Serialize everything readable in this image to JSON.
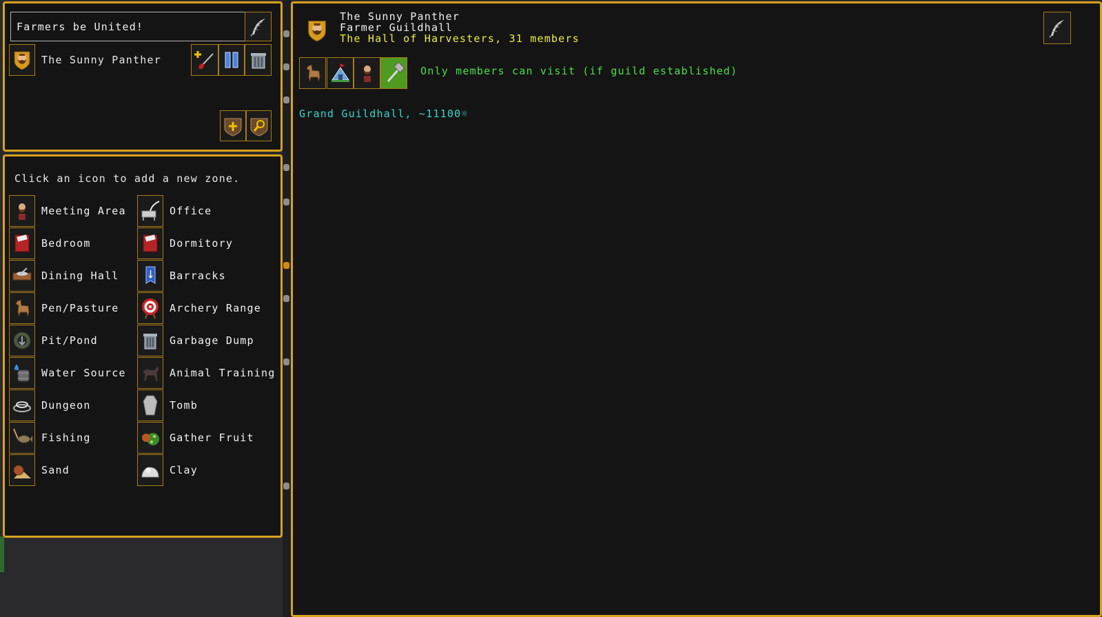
{
  "location_panel": {
    "name_value": "Farmers be United!",
    "occupant_name": "The Sunny Panther",
    "occupant_icon": "dwarf-portrait-icon",
    "buttons": [
      "assign-icon",
      "pause-icon",
      "trash-icon",
      "add-zone-icon",
      "search-icon",
      "edit-quill-icon"
    ]
  },
  "zones_panel": {
    "instruction": "Click an icon to add a new zone.",
    "left_column": [
      {
        "label": "Meeting Area",
        "icon": "meeting-area-icon"
      },
      {
        "label": "Bedroom",
        "icon": "bed-icon"
      },
      {
        "label": "Dining Hall",
        "icon": "dining-table-icon"
      },
      {
        "label": "Pen/Pasture",
        "icon": "horse-icon"
      },
      {
        "label": "Pit/Pond",
        "icon": "pit-icon"
      },
      {
        "label": "Water Source",
        "icon": "water-barrel-icon"
      },
      {
        "label": "Dungeon",
        "icon": "chain-icon"
      },
      {
        "label": "Fishing",
        "icon": "fish-icon"
      },
      {
        "label": "Sand",
        "icon": "sand-bag-icon"
      }
    ],
    "right_column": [
      {
        "label": "Office",
        "icon": "desk-quill-icon"
      },
      {
        "label": "Dormitory",
        "icon": "bed-icon"
      },
      {
        "label": "Barracks",
        "icon": "banner-icon"
      },
      {
        "label": "Archery Range",
        "icon": "target-icon"
      },
      {
        "label": "Garbage Dump",
        "icon": "trash-icon"
      },
      {
        "label": "Animal Training",
        "icon": "dog-icon"
      },
      {
        "label": "Tomb",
        "icon": "coffin-icon"
      },
      {
        "label": "Gather Fruit",
        "icon": "fruit-bush-icon"
      },
      {
        "label": "Clay",
        "icon": "clay-icon"
      }
    ]
  },
  "detail_panel": {
    "occupant_name": "The Sunny Panther",
    "location_type": "Farmer Guildhall",
    "location_desc": "The Hall of Harvesters, 31 members",
    "access_text": "Only members can visit (if guild established)",
    "tier_text": "Grand Guildhall, ~11100☼",
    "strip_icons": [
      "horse-icon",
      "tent-icon",
      "dwarf-icon",
      "hammer-icon"
    ]
  },
  "colors": {
    "border": "#d9a21c",
    "panel": "#141414",
    "green": "#48e048",
    "cyan": "#33d6cf",
    "yellow": "#eded3a",
    "selected_tile": "#4f9a21"
  }
}
